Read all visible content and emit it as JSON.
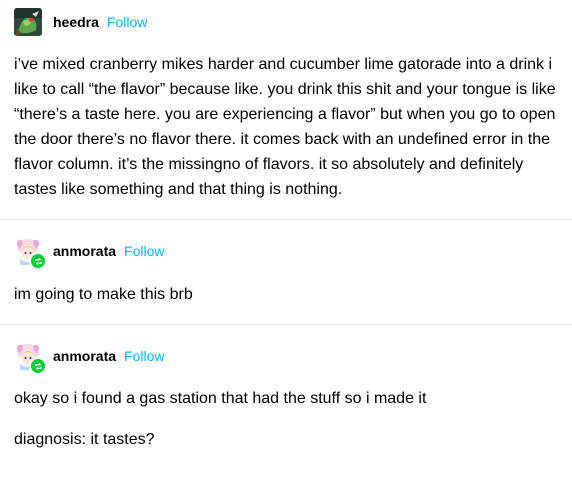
{
  "posts": [
    {
      "username": "heedra",
      "follow_label": "Follow",
      "text": "i’ve mixed cranberry mikes harder and cucumber lime gatorade into a drink i like to call “the flavor” because like. you drink this shit and your tongue is like “there’s a taste here. you are experiencing a flavor” but when you go to open the door there’s no flavor there. it comes back with an undefined error in the flavor column. it’s the missingno of flavors. it so absolutely and definitely tastes like something and that thing is nothing."
    },
    {
      "username": "anmorata",
      "follow_label": "Follow",
      "text": "im going to make this brb"
    },
    {
      "username": "anmorata",
      "follow_label": "Follow",
      "paragraphs": [
        "okay so i found a gas station that had the stuff so i made it",
        "diagnosis: it tastes?"
      ]
    }
  ],
  "colors": {
    "follow": "#00b8ff",
    "reblog_badge": "#00cf35",
    "divider": "#e5e5e5"
  }
}
